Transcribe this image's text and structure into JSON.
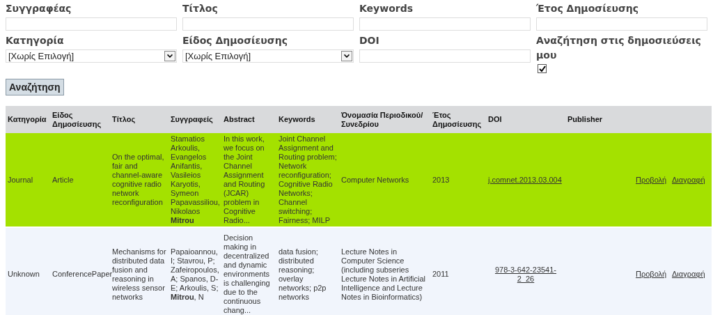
{
  "filters": [
    {
      "kind": "text",
      "label": "Συγγραφέας"
    },
    {
      "kind": "text",
      "label": "Τίτλος"
    },
    {
      "kind": "text",
      "label": "Keywords"
    },
    {
      "kind": "text",
      "label": "Έτος Δημοσίευσης"
    },
    {
      "kind": "select",
      "label": "Κατηγορία",
      "value": "[Χωρίς Επιλογή]"
    },
    {
      "kind": "select",
      "label": "Είδος Δημοσίευσης",
      "value": "[Χωρίς Επιλογή]"
    },
    {
      "kind": "text",
      "label": "DOI"
    },
    {
      "kind": "checkbox",
      "label": "Αναζήτηση στις δημοσιεύσεις μου",
      "checked": true
    }
  ],
  "search_button": "Αναζήτηση",
  "table": {
    "columns": [
      "Κατηγορία",
      "Είδος Δημοσίευσης",
      "Τίτλος",
      "Συγγραφείς",
      "Abstract",
      "Keywords",
      "Όνομασία Περιοδικού/Συνεδρίου",
      "Έτος Δημοσίευσης",
      "DOI",
      "Publisher"
    ],
    "rows": [
      {
        "selected": true,
        "category": "Journal",
        "type": "Article",
        "title": "On the optimal, fair and channel-aware cognitive radio network reconfiguration",
        "authors": "Stamatios Arkoulis, Evangelos Anifantis, Vasileios Karyotis, Symeon Papavassiliou, Nikolaos **Mitrou**",
        "abstract": "In this work, we focus on the Joint Channel Assignment and Routing (JCAR) problem in Cognitive Radio...",
        "keywords": "Joint Channel Assignment and Routing problem; Network reconfiguration; Cognitive Radio Networks; Channel switching; Fairness; MILP",
        "venue": "Computer Networks",
        "year": "2013",
        "doi": "j.comnet.2013.03.004",
        "view": "Προβολή",
        "delete": "Διαγραφή"
      },
      {
        "selected": false,
        "category": "Unknown",
        "type": "ConferencePaper",
        "title": "Mechanisms for distributed data fusion and reasoning in wireless sensor networks",
        "authors": "Papaioannou, I; Stavrou, P; Zafeiropoulos, A; Spanos, D-E; Arkoulis, S; **Mitrou**, N",
        "abstract": "Decision making in decentralized and dynamic environments is challenging due to the continuous chang...",
        "keywords": "data fusion; distributed reasoning; overlay networks; p2p networks",
        "venue": "Lecture Notes in Computer Science (including subseries Lecture Notes in Artificial Intelligence and Lecture Notes in Bioinformatics)",
        "year": "2011",
        "doi": "978-3-642-23541-2_26",
        "view": "Προβολή",
        "delete": "Διαγραφή"
      }
    ]
  }
}
